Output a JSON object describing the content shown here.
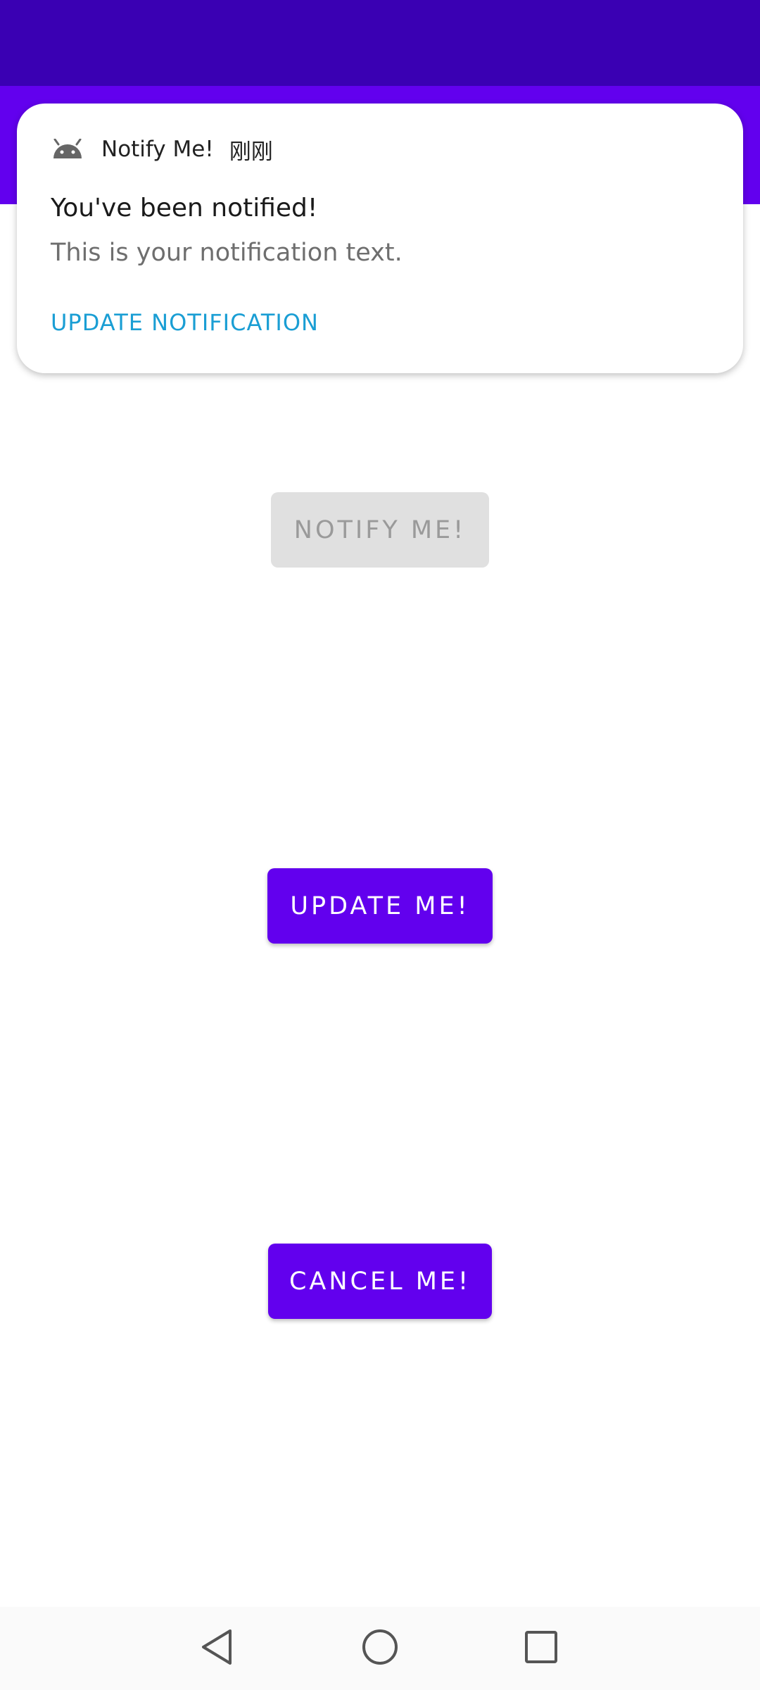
{
  "notification": {
    "app_name": "Notify Me!",
    "time": "刚刚",
    "title": "You've been notified!",
    "text": "This is your notification text.",
    "action_label": "UPDATE NOTIFICATION",
    "icon": "android-icon"
  },
  "buttons": {
    "notify_label": "NOTIFY ME!",
    "notify_enabled": false,
    "update_label": "UPDATE ME!",
    "cancel_label": "CANCEL ME!"
  },
  "navigation": {
    "back_icon": "back-icon",
    "home_icon": "home-icon",
    "recents_icon": "recents-icon"
  },
  "colors": {
    "status_bar": "#3a00b3",
    "app_bar": "#6200ee",
    "primary_button": "#6200ee",
    "disabled_button": "#e0e0e0",
    "notification_action": "#1a9ed4"
  }
}
